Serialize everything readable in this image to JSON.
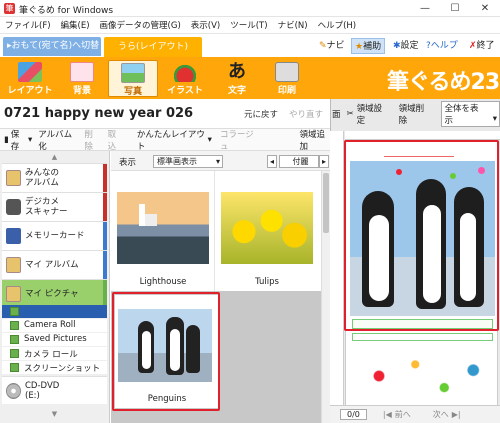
{
  "window": {
    "title": "筆ぐるめ for Windows",
    "minimize": "—",
    "maximize": "☐",
    "close": "✕"
  },
  "menu": [
    "ファイル(F)",
    "編集(E)",
    "画像データの管理(G)",
    "表示(V)",
    "ツール(T)",
    "ナビ(N)",
    "ヘルプ(H)"
  ],
  "tabs": {
    "back": "▸おもて(宛て名)へ切替",
    "layout": "うら(レイアウト)"
  },
  "tab_tools": {
    "navi": "ナビ",
    "assist": "補助",
    "settings": "設定",
    "help": "?ヘルプ",
    "exit": "終了"
  },
  "ribbon": {
    "layout": "レイアウト",
    "background": "背景",
    "photo": "写真",
    "illust": "イラスト",
    "text": "文字",
    "print": "印刷",
    "logo": "筆ぐるめ23"
  },
  "doc": {
    "title": "0721  happy new year  026",
    "undo": "元に戻す",
    "redo": "やり直す"
  },
  "toolbar2": {
    "save": "保存",
    "album": "アルバム化",
    "delete": "削除",
    "import": "取込",
    "easy_layout": "かんたんレイアウト",
    "collage": "コラージュ",
    "add_area": "領域追加"
  },
  "right_tools": {
    "left_label": "面",
    "area_settings": "領域設定",
    "area_delete": "領域削除",
    "view_select": "全体を表示"
  },
  "sidebar": {
    "items": [
      {
        "label1": "みんなの",
        "label2": "アルバム"
      },
      {
        "label1": "デジカメ",
        "label2": "スキャナー"
      },
      {
        "label1": "メモリーカード",
        "label2": ""
      },
      {
        "label1": "マイ アルバム",
        "label2": ""
      },
      {
        "label1": "マイ ピクチャ",
        "label2": ""
      }
    ],
    "subitems": [
      "",
      "Camera Roll",
      "Saved Pictures",
      "カメラ ロール",
      "スクリーンショット"
    ],
    "drive": {
      "label1": "CD-DVD",
      "label2": "(E:)"
    }
  },
  "view": {
    "label": "表示",
    "mode": "標準画表示",
    "sort": "付麗"
  },
  "gallery": [
    {
      "name": "Lighthouse"
    },
    {
      "name": "Tulips"
    },
    {
      "name": "Penguins"
    }
  ],
  "pager": {
    "count": "0/0",
    "prev": "前へ",
    "next": "次へ"
  },
  "colors": {
    "orange": "#ffa60a",
    "highlight": "#e0202a",
    "blue": "#7fb0e5"
  }
}
